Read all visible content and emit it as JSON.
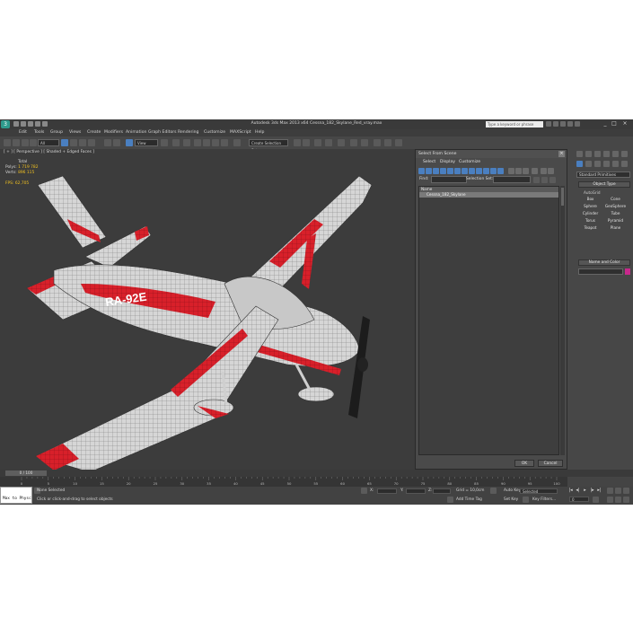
{
  "titlebar": {
    "title": "Autodesk 3ds Max  2013 x64      Cessna_182_Skylane_Red_vray.max",
    "search_placeholder": "Type a keyword or phrase"
  },
  "menu": [
    "Edit",
    "Tools",
    "Group",
    "Views",
    "Create",
    "Modifiers",
    "Animation",
    "Graph Editors",
    "Rendering",
    "Customize",
    "MAXScript",
    "Help"
  ],
  "toolbar": {
    "filter_value": "All",
    "refcoord_value": "View",
    "named_sel_value": "Create Selection Set"
  },
  "viewport": {
    "label": "[ + ] [ Perspective ] [ Shaded + Edged Faces ]",
    "stats_total": "Total",
    "polys_label": "Polys:",
    "polys_value": "1 719 782",
    "verts_label": "Verts:",
    "verts_value": "896 115",
    "fps_label": "FPS:",
    "fps_value": "62,705",
    "registration": "RA-92E"
  },
  "dialog": {
    "title": "Select From Scene",
    "menu": [
      "Select",
      "Display",
      "Customize"
    ],
    "find_label": "Find:",
    "selset_label": "Selection Set:",
    "column_header": "Name",
    "rows": [
      "Cessna_182_Skylane"
    ],
    "ok_label": "OK",
    "cancel_label": "Cancel"
  },
  "command_panel": {
    "dropdown_value": "Standard Primitives",
    "object_type_title": "Object Type",
    "autogrid_label": "AutoGrid",
    "object_buttons": [
      "Box",
      "Cone",
      "Sphere",
      "GeoSphere",
      "Cylinder",
      "Tube",
      "Torus",
      "Pyramid",
      "Teapot",
      "Plane"
    ],
    "name_color_title": "Name and Color"
  },
  "timeline": {
    "slider_label": "0 / 100",
    "ticks": [
      "0",
      "5",
      "10",
      "15",
      "20",
      "25",
      "30",
      "35",
      "40",
      "45",
      "50",
      "55",
      "60",
      "65",
      "70",
      "75",
      "80",
      "85",
      "90",
      "95",
      "100"
    ]
  },
  "status": {
    "listener_text": "Max to Physc",
    "selection_status": "None Selected",
    "prompt": "Click or click-and-drag to select objects",
    "x_label": "X:",
    "y_label": "Y:",
    "z_label": "Z:",
    "grid_text": "Grid = 10,0cm",
    "auto_key": "Auto Key",
    "auto_key_value": "Selected",
    "set_key": "Set Key",
    "key_filters": "Key Filters...",
    "add_time_tag": "Add Time Tag",
    "frame_value": "0"
  },
  "colors": {
    "plane_red": "#d8202a",
    "plane_white": "#dcdcdc",
    "accent_blue": "#4a7fc0"
  }
}
